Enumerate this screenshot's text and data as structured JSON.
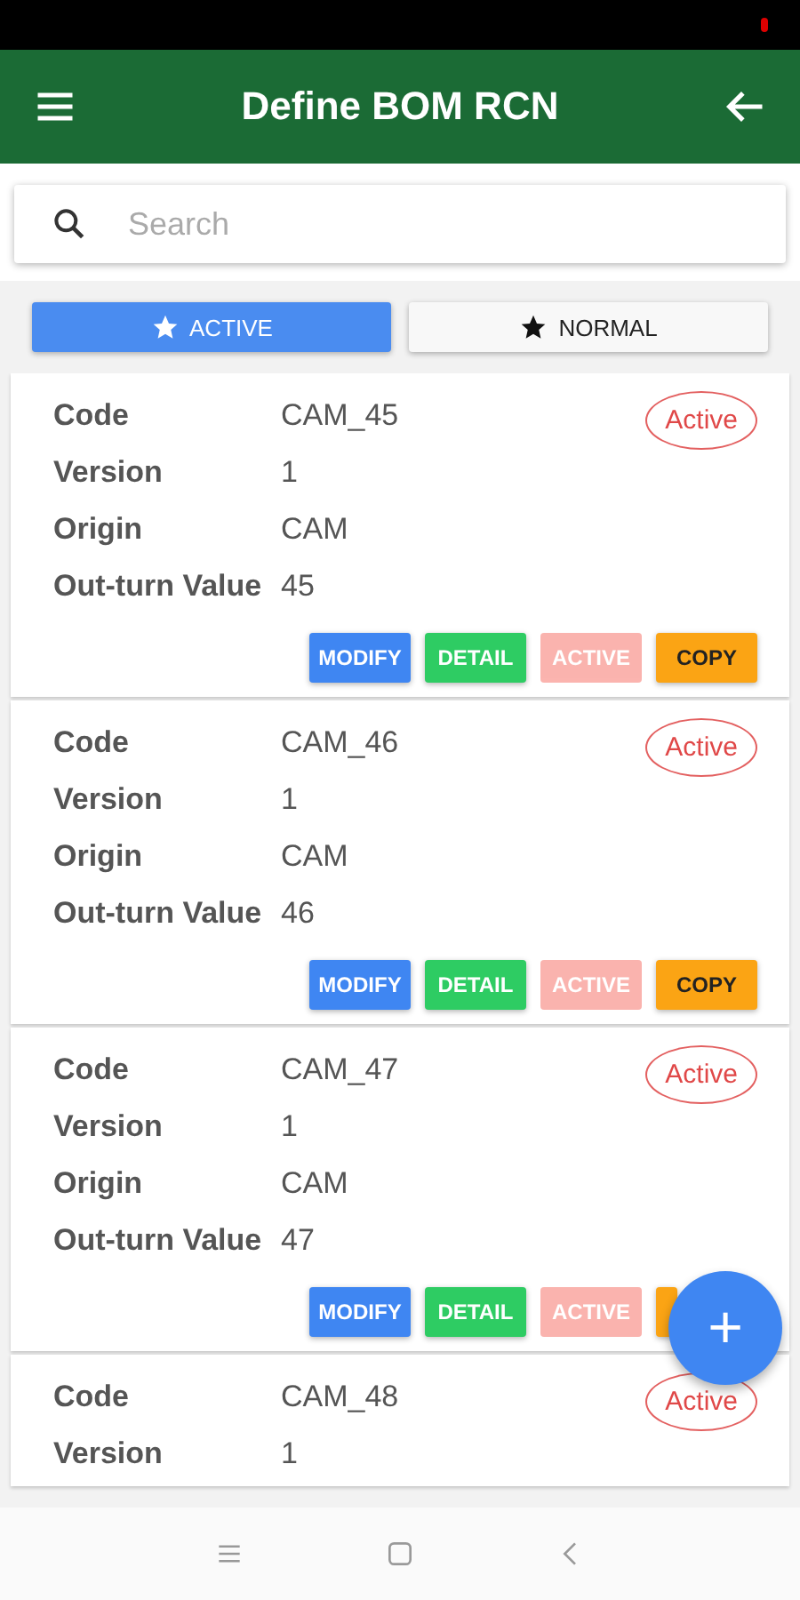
{
  "app_bar": {
    "title": "Define BOM RCN"
  },
  "search": {
    "placeholder": "Search"
  },
  "tabs": [
    {
      "label": "ACTIVE",
      "selected": true
    },
    {
      "label": "NORMAL",
      "selected": false
    }
  ],
  "records": [
    {
      "fields": [
        {
          "label": "Code",
          "value": "CAM_45"
        },
        {
          "label": "Version",
          "value": "1"
        },
        {
          "label": "Origin",
          "value": "CAM"
        },
        {
          "label": "Out-turn Value",
          "value": "45"
        }
      ],
      "status": "Active",
      "actions": [
        {
          "kind": "modify",
          "label": "MODIFY",
          "disabled": false
        },
        {
          "kind": "detail",
          "label": "DETAIL",
          "disabled": false
        },
        {
          "kind": "active",
          "label": "ACTIVE",
          "disabled": true
        },
        {
          "kind": "copy",
          "label": "COPY",
          "disabled": false
        }
      ]
    },
    {
      "fields": [
        {
          "label": "Code",
          "value": "CAM_46"
        },
        {
          "label": "Version",
          "value": "1"
        },
        {
          "label": "Origin",
          "value": "CAM"
        },
        {
          "label": "Out-turn Value",
          "value": "46"
        }
      ],
      "status": "Active",
      "actions": [
        {
          "kind": "modify",
          "label": "MODIFY",
          "disabled": false
        },
        {
          "kind": "detail",
          "label": "DETAIL",
          "disabled": false
        },
        {
          "kind": "active",
          "label": "ACTIVE",
          "disabled": true
        },
        {
          "kind": "copy",
          "label": "COPY",
          "disabled": false
        }
      ]
    },
    {
      "fields": [
        {
          "label": "Code",
          "value": "CAM_47"
        },
        {
          "label": "Version",
          "value": "1"
        },
        {
          "label": "Origin",
          "value": "CAM"
        },
        {
          "label": "Out-turn Value",
          "value": "47"
        }
      ],
      "status": "Active",
      "actions": [
        {
          "kind": "modify",
          "label": "MODIFY",
          "disabled": false
        },
        {
          "kind": "detail",
          "label": "DETAIL",
          "disabled": false
        },
        {
          "kind": "active",
          "label": "ACTIVE",
          "disabled": true
        },
        {
          "kind": "copy",
          "disabled": false
        }
      ]
    },
    {
      "fields": [
        {
          "label": "Code",
          "value": "CAM_48"
        },
        {
          "label": "Version",
          "value": "1"
        }
      ],
      "status": "Active"
    }
  ],
  "fab": {
    "label": "+"
  }
}
